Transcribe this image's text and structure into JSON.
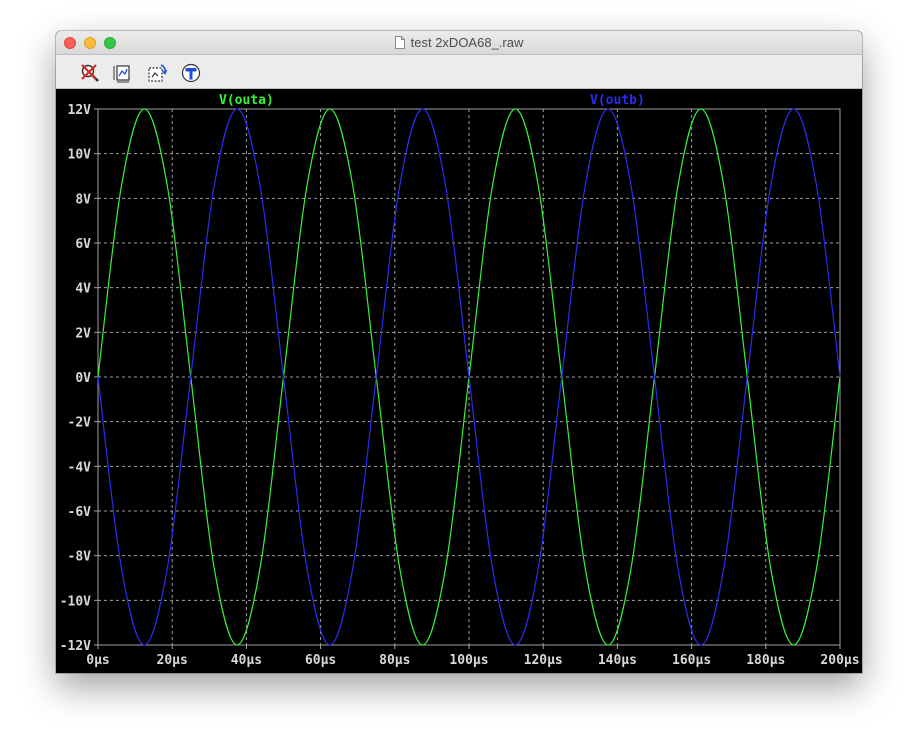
{
  "window": {
    "title": "test 2xDOA68_.raw"
  },
  "toolbar": {
    "buttons": [
      {
        "name": "zoom-cancel",
        "icon": "zoom-cancel-icon"
      },
      {
        "name": "autorange",
        "icon": "autorange-icon"
      },
      {
        "name": "undo-zoom",
        "icon": "undo-zoom-icon"
      },
      {
        "name": "pan",
        "icon": "pan-icon"
      }
    ]
  },
  "chart_data": {
    "type": "line",
    "x_ticks": [
      "0µs",
      "20µs",
      "40µs",
      "60µs",
      "80µs",
      "100µs",
      "120µs",
      "140µs",
      "160µs",
      "180µs",
      "200µs"
    ],
    "y_ticks": [
      "12V",
      "10V",
      "8V",
      "6V",
      "4V",
      "2V",
      "0V",
      "-2V",
      "-4V",
      "-6V",
      "-8V",
      "-10V",
      "-12V"
    ],
    "xlim": [
      0,
      200
    ],
    "ylim": [
      -12,
      12
    ],
    "x_unit": "µs",
    "y_unit": "V",
    "grid": true,
    "colors": {
      "background": "#000000",
      "grid": "#a0a0a0",
      "axis": "#a0a0a0",
      "tick_label": "#d8d8d8"
    },
    "series": [
      {
        "name": "V(outa)",
        "color": "#36f23a",
        "x": [
          0,
          6.25,
          12.5,
          18.75,
          25,
          31.25,
          37.5,
          43.75,
          50,
          56.25,
          62.5,
          68.75,
          75,
          81.25,
          87.5,
          93.75,
          100,
          106.25,
          112.5,
          118.75,
          125,
          131.25,
          137.5,
          143.75,
          150,
          156.25,
          162.5,
          168.75,
          175,
          181.25,
          187.5,
          193.75,
          200
        ],
        "y": [
          0,
          8.49,
          12,
          8.49,
          0,
          -8.49,
          -12,
          -8.49,
          0,
          8.49,
          12,
          8.49,
          0,
          -8.49,
          -12,
          -8.49,
          0,
          8.49,
          12,
          8.49,
          0,
          -8.49,
          -12,
          -8.49,
          0,
          8.49,
          12,
          8.49,
          0,
          -8.49,
          -12,
          -8.49,
          0
        ]
      },
      {
        "name": "V(outb)",
        "color": "#2c2cf0",
        "x": [
          0,
          6.25,
          12.5,
          18.75,
          25,
          31.25,
          37.5,
          43.75,
          50,
          56.25,
          62.5,
          68.75,
          75,
          81.25,
          87.5,
          93.75,
          100,
          106.25,
          112.5,
          118.75,
          125,
          131.25,
          137.5,
          143.75,
          150,
          156.25,
          162.5,
          168.75,
          175,
          181.25,
          187.5,
          193.75,
          200
        ],
        "y": [
          0,
          -8.49,
          -12,
          -8.49,
          0,
          8.49,
          12,
          8.49,
          0,
          -8.49,
          -12,
          -8.49,
          0,
          8.49,
          12,
          8.49,
          0,
          -8.49,
          -12,
          -8.49,
          0,
          8.49,
          12,
          8.49,
          0,
          -8.49,
          -12,
          -8.49,
          0,
          8.49,
          12,
          8.49,
          0
        ]
      }
    ]
  }
}
